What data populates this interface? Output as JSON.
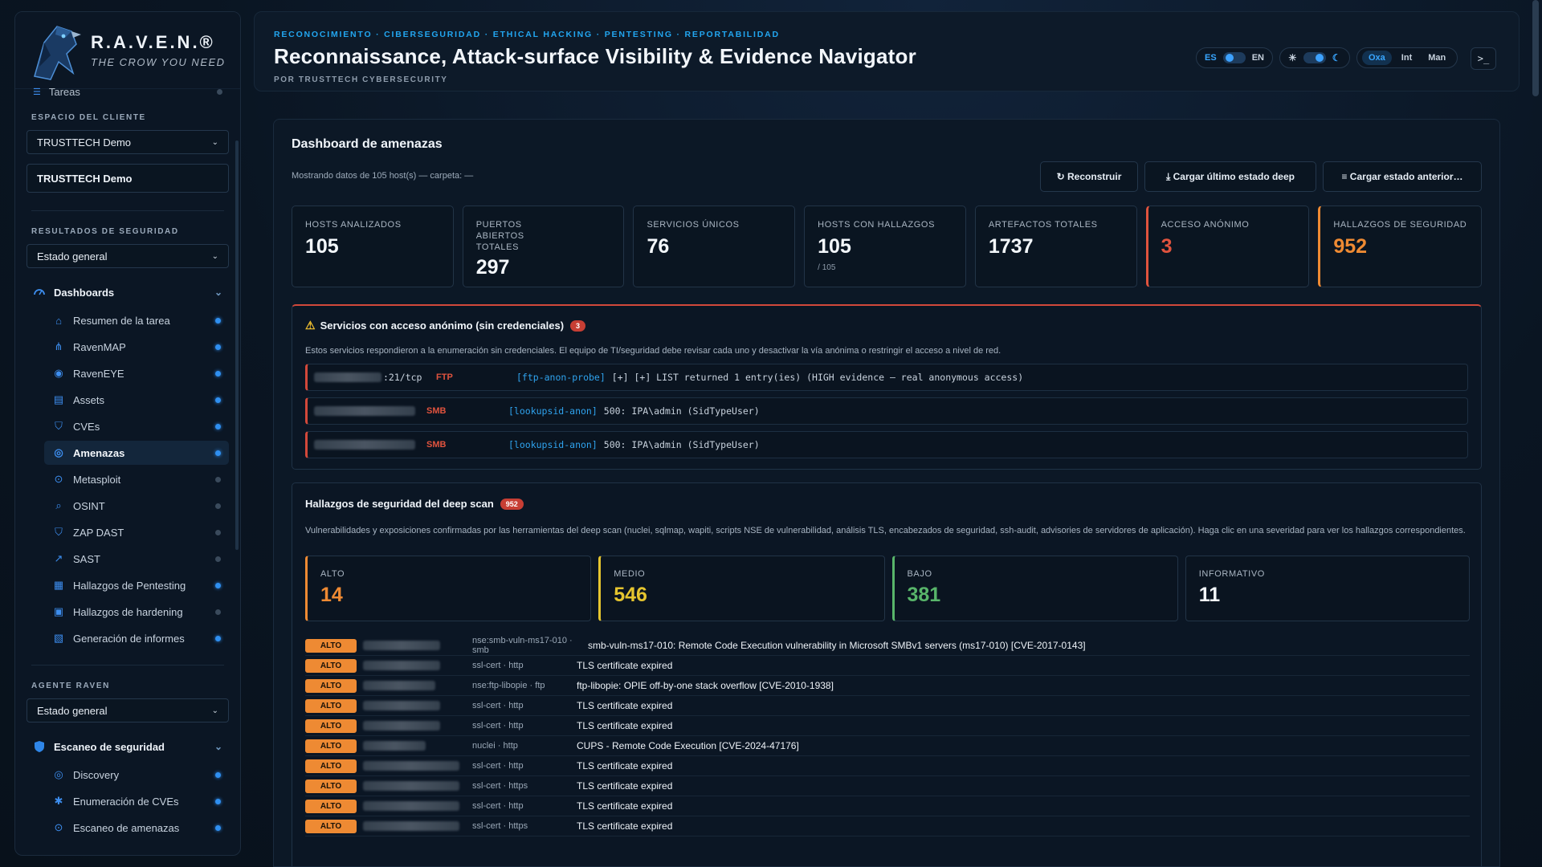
{
  "brand": {
    "title": "R.A.V.E.N.®",
    "tagline": "THE CROW YOU NEED"
  },
  "sidebar": {
    "cut_item": "Tareas",
    "client_label": "ESPACIO DEL CLIENTE",
    "client_select": "TRUSTTECH Demo",
    "client_box": "TRUSTTECH Demo",
    "results_label": "RESULTADOS DE SEGURIDAD",
    "results_select": "Estado general",
    "dashboards_label": "Dashboards",
    "dashboards": [
      {
        "label": "Resumen de la tarea",
        "icon": "home-icon",
        "status": "on"
      },
      {
        "label": "RavenMAP",
        "icon": "network-icon",
        "status": "on"
      },
      {
        "label": "RavenEYE",
        "icon": "eye-icon",
        "status": "on"
      },
      {
        "label": "Assets",
        "icon": "server-icon",
        "status": "on"
      },
      {
        "label": "CVEs",
        "icon": "shield-icon",
        "status": "on"
      },
      {
        "label": "Amenazas",
        "icon": "radar-icon",
        "status": "on",
        "active": true
      },
      {
        "label": "Metasploit",
        "icon": "target-icon",
        "status": "off"
      },
      {
        "label": "OSINT",
        "icon": "search-icon",
        "status": "off"
      },
      {
        "label": "ZAP DAST",
        "icon": "shield-check-icon",
        "status": "off"
      },
      {
        "label": "SAST",
        "icon": "chart-icon",
        "status": "off"
      },
      {
        "label": "Hallazgos de Pentesting",
        "icon": "report-icon",
        "status": "on"
      },
      {
        "label": "Hallazgos de hardening",
        "icon": "clipboard-icon",
        "status": "off"
      },
      {
        "label": "Generación de informes",
        "icon": "document-icon",
        "status": "on"
      }
    ],
    "agent_label": "AGENTE RAVEN",
    "agent_select": "Estado general",
    "scan_label": "Escaneo de seguridad",
    "scan_items": [
      {
        "label": "Discovery",
        "icon": "radar-icon",
        "status": "on"
      },
      {
        "label": "Enumeración de CVEs",
        "icon": "bug-icon",
        "status": "on"
      },
      {
        "label": "Escaneo de amenazas",
        "icon": "target-icon",
        "status": "on"
      }
    ]
  },
  "header": {
    "kicker": "RECONOCIMIENTO · CIBERSEGURIDAD · ETHICAL HACKING · PENTESTING · REPORTABILIDAD",
    "title": "Reconnaissance, Attack-surface Visibility & Evidence Navigator",
    "byline": "POR TRUSTTECH CYBERSECURITY",
    "lang_es": "ES",
    "lang_en": "EN",
    "mode_oxa": "Oxa",
    "mode_int": "Int",
    "mode_man": "Man",
    "terminal": ">_"
  },
  "dashboard": {
    "title": "Dashboard de amenazas",
    "subtitle": "Mostrando datos de 105 host(s) — carpeta: —",
    "btn_rebuild": "↻ Reconstruir",
    "btn_load_last": "⤓ Cargar último estado deep",
    "btn_load_prev": "≡ Cargar estado anterior…",
    "stats": [
      {
        "label": "HOSTS ANALIZADOS",
        "value": "105",
        "sub": ""
      },
      {
        "label": "PUERTOS ABIERTOS TOTALES",
        "value": "297",
        "sub": ""
      },
      {
        "label": "SERVICIOS ÚNICOS",
        "value": "76",
        "sub": ""
      },
      {
        "label": "HOSTS CON HALLAZGOS",
        "value": "105",
        "sub": "/ 105"
      },
      {
        "label": "ARTEFACTOS TOTALES",
        "value": "1737",
        "sub": ""
      },
      {
        "label": "ACCESO ANÓNIMO",
        "value": "3",
        "sub": ""
      },
      {
        "label": "HALLAZGOS DE SEGURIDAD",
        "value": "952",
        "sub": ""
      }
    ]
  },
  "anon": {
    "title": "Servicios con acceso anónimo (sin credenciales)",
    "count": "3",
    "description": "Estos servicios respondieron a la enumeración sin credenciales. El equipo de TI/seguridad debe revisar cada uno y desactivar la vía anónima o restringir el acceso a nivel de red.",
    "rows": [
      {
        "port": ":21/tcp",
        "proto": "FTP",
        "probe": "[ftp-anon-probe]",
        "evidence": "[+] [+] LIST returned 1 entry(ies) (HIGH evidence — real anonymous access)"
      },
      {
        "port": "",
        "proto": "SMB",
        "probe": "[lookupsid-anon]",
        "evidence": "500: IPA\\admin (SidTypeUser)"
      },
      {
        "port": "",
        "proto": "SMB",
        "probe": "[lookupsid-anon]",
        "evidence": "500: IPA\\admin (SidTypeUser)"
      }
    ]
  },
  "deep": {
    "title": "Hallazgos de seguridad del deep scan",
    "count": "952",
    "description": "Vulnerabilidades y exposiciones confirmadas por las herramientas del deep scan (nuclei, sqlmap, wapiti, scripts NSE de vulnerabilidad, análisis TLS, encabezados de seguridad, ssh-audit, advisories de servidores de aplicación). Haga clic en una severidad para ver los hallazgos correspondientes.",
    "severities": [
      {
        "label": "ALTO",
        "value": "14"
      },
      {
        "label": "MEDIO",
        "value": "546"
      },
      {
        "label": "BAJO",
        "value": "381"
      },
      {
        "label": "INFORMATIVO",
        "value": "11"
      }
    ],
    "findings": [
      {
        "sev": "ALTO",
        "source": "nse:smb-vuln-ms17-010 · smb",
        "title": "smb-vuln-ms17-010: Remote Code Execution vulnerability in Microsoft SMBv1 servers (ms17-010) [CVE-2017-0143]"
      },
      {
        "sev": "ALTO",
        "source": "ssl-cert · http",
        "title": "TLS certificate expired"
      },
      {
        "sev": "ALTO",
        "source": "nse:ftp-libopie · ftp",
        "title": "ftp-libopie: OPIE off-by-one stack overflow [CVE-2010-1938]"
      },
      {
        "sev": "ALTO",
        "source": "ssl-cert · http",
        "title": "TLS certificate expired"
      },
      {
        "sev": "ALTO",
        "source": "ssl-cert · http",
        "title": "TLS certificate expired"
      },
      {
        "sev": "ALTO",
        "source": "nuclei · http",
        "title": "CUPS - Remote Code Execution [CVE-2024-47176]"
      },
      {
        "sev": "ALTO",
        "source": "ssl-cert · http",
        "title": "TLS certificate expired"
      },
      {
        "sev": "ALTO",
        "source": "ssl-cert · https",
        "title": "TLS certificate expired"
      },
      {
        "sev": "ALTO",
        "source": "ssl-cert · http",
        "title": "TLS certificate expired"
      },
      {
        "sev": "ALTO",
        "source": "ssl-cert · https",
        "title": "TLS certificate expired"
      }
    ]
  }
}
